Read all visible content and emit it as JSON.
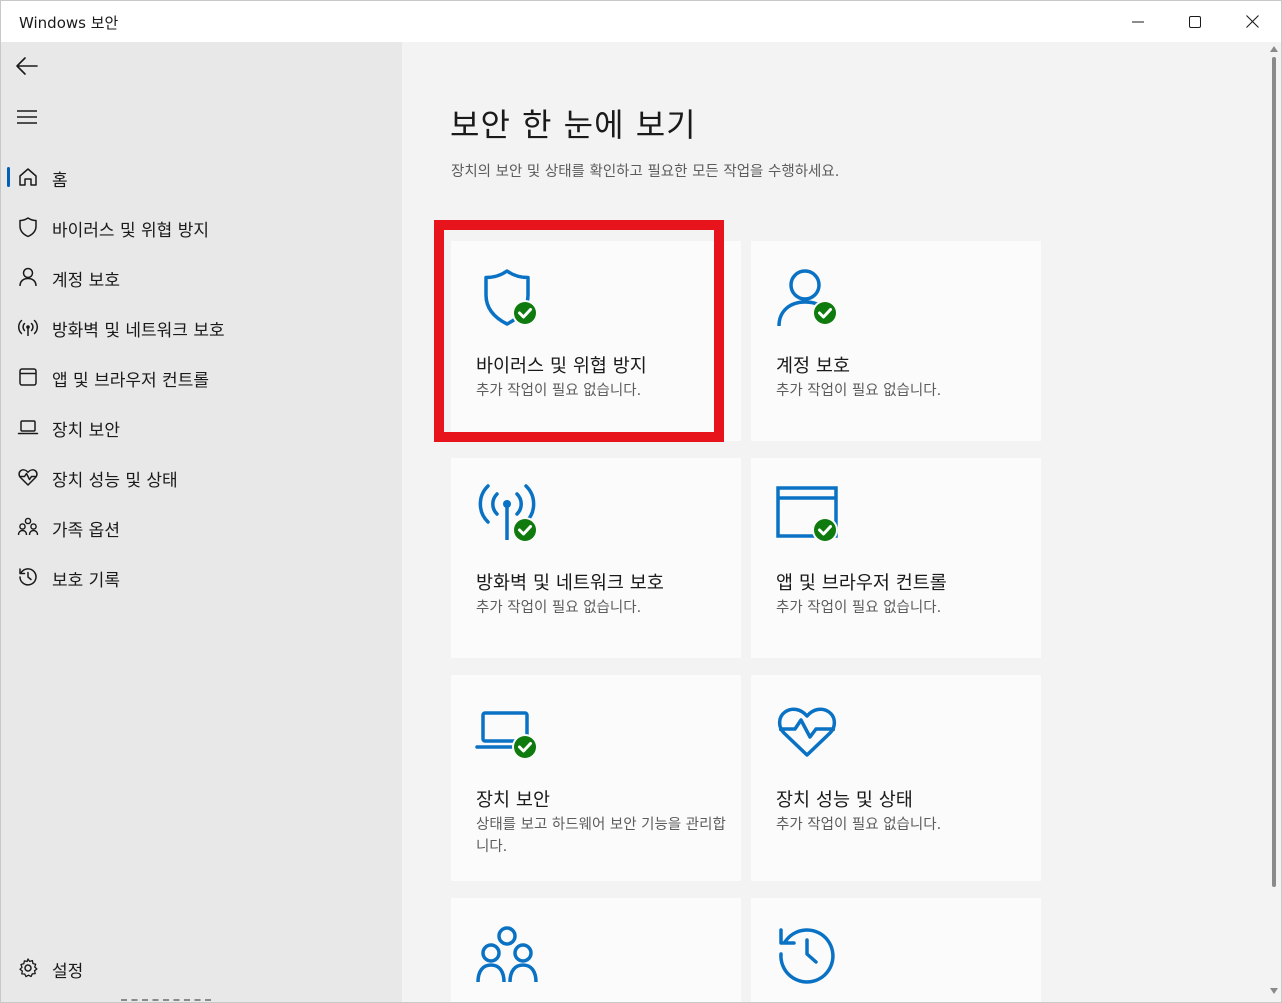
{
  "window": {
    "title": "Windows 보안",
    "minimize_glyph": "minimize-icon",
    "maximize_glyph": "maximize-icon",
    "close_glyph": "close-icon"
  },
  "sidebar": {
    "items": [
      {
        "label": "홈",
        "icon": "home-icon",
        "active": true
      },
      {
        "label": "바이러스 및 위협 방지",
        "icon": "shield-icon"
      },
      {
        "label": "계정 보호",
        "icon": "person-icon"
      },
      {
        "label": "방화벽 및 네트워크 보호",
        "icon": "wifi-signal-icon"
      },
      {
        "label": "앱 및 브라우저 컨트롤",
        "icon": "browser-window-icon"
      },
      {
        "label": "장치 보안",
        "icon": "laptop-icon"
      },
      {
        "label": "장치 성능 및 상태",
        "icon": "heart-pulse-icon"
      },
      {
        "label": "가족 옵션",
        "icon": "family-icon"
      },
      {
        "label": "보호 기록",
        "icon": "history-icon"
      }
    ],
    "settings_label": "설정"
  },
  "main": {
    "title": "보안 한 눈에 보기",
    "subtitle": "장치의 보안 및 상태를 확인하고 필요한 모든 작업을 수행하세요.",
    "cards": [
      {
        "title": "바이러스 및 위협 방지",
        "status": "추가 작업이 필요 없습니다.",
        "icon": "shield-check-icon"
      },
      {
        "title": "계정 보호",
        "status": "추가 작업이 필요 없습니다.",
        "icon": "person-check-icon"
      },
      {
        "title": "방화벽 및 네트워크 보호",
        "status": "추가 작업이 필요 없습니다.",
        "icon": "wifi-check-icon"
      },
      {
        "title": "앱 및 브라우저 컨트롤",
        "status": "추가 작업이 필요 없습니다.",
        "icon": "browser-check-icon"
      },
      {
        "title": "장치 보안",
        "status": "상태를 보고 하드웨어 보안 기능을 관리합니다.",
        "icon": "laptop-check-icon"
      },
      {
        "title": "장치 성능 및 상태",
        "status": "추가 작업이 필요 없습니다.",
        "icon": "heart-pulse-icon"
      },
      {
        "title": "",
        "status": "",
        "icon": "family-icon"
      },
      {
        "title": "",
        "status": "",
        "icon": "history-icon"
      }
    ]
  },
  "colors": {
    "accent": "#005fb8",
    "icon_blue": "#0a72c4",
    "check_green": "#0f7b0f",
    "highlight": "#e8141c"
  }
}
